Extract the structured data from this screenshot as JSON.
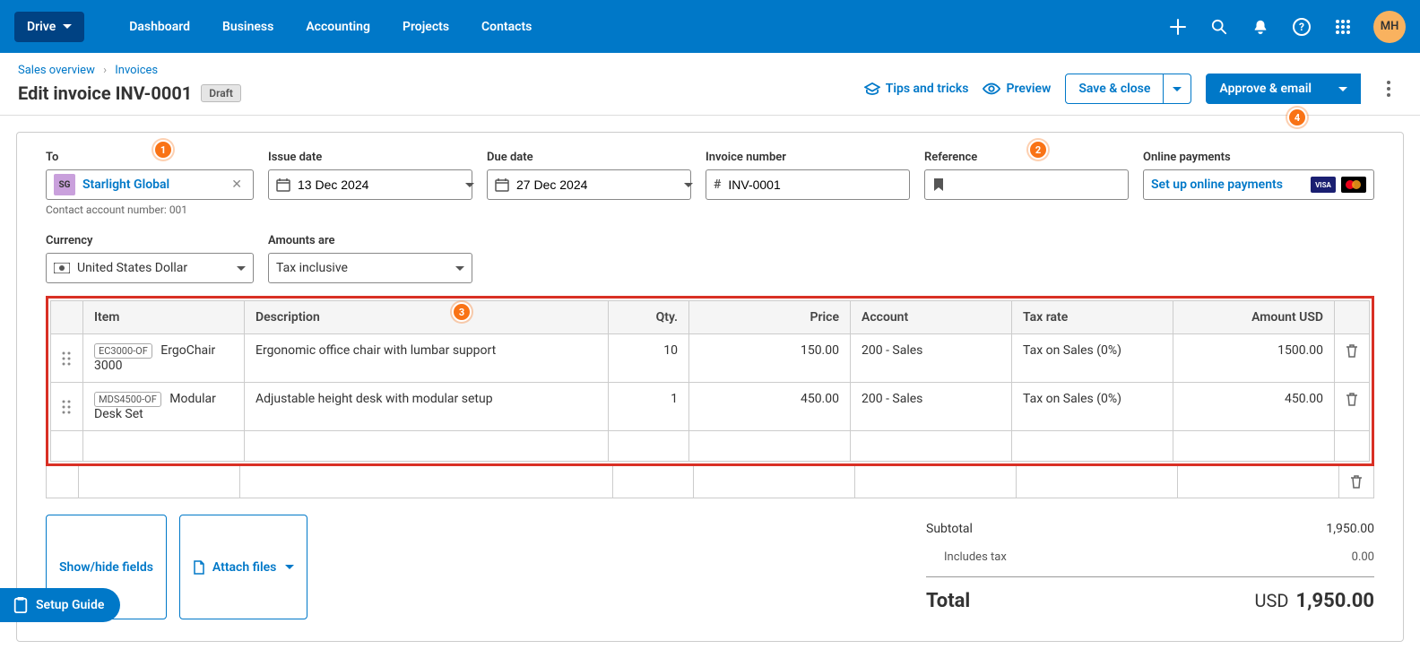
{
  "nav": {
    "org": "Drive",
    "links": [
      "Dashboard",
      "Business",
      "Accounting",
      "Projects",
      "Contacts"
    ],
    "avatar": "MH"
  },
  "breadcrumb": {
    "a": "Sales overview",
    "b": "Invoices"
  },
  "title": "Edit invoice INV-0001",
  "status": "Draft",
  "header_actions": {
    "tips": "Tips and tricks",
    "preview": "Preview",
    "save": "Save & close",
    "approve": "Approve & email"
  },
  "form": {
    "to_label": "To",
    "to_chip": "SG",
    "to_name": "Starlight Global",
    "to_help": "Contact account number: 001",
    "issue_label": "Issue date",
    "issue_value": "13 Dec 2024",
    "due_label": "Due date",
    "due_value": "27 Dec 2024",
    "invnum_label": "Invoice number",
    "invnum_value": "INV-0001",
    "ref_label": "Reference",
    "ref_value": "",
    "online_label": "Online payments",
    "online_btn": "Set up online payments",
    "currency_label": "Currency",
    "currency_value": "United States Dollar",
    "amounts_label": "Amounts are",
    "amounts_value": "Tax inclusive"
  },
  "columns": {
    "item": "Item",
    "desc": "Description",
    "qty": "Qty.",
    "price": "Price",
    "account": "Account",
    "tax": "Tax rate",
    "amount": "Amount USD"
  },
  "lines": [
    {
      "code": "EC3000-OF",
      "name": "ErgoChair 3000",
      "desc": "Ergonomic office chair with lumbar support",
      "qty": "10",
      "price": "150.00",
      "account": "200 - Sales",
      "tax": "Tax on Sales (0%)",
      "amount": "1500.00"
    },
    {
      "code": "MDS4500-OF",
      "name": "Modular Desk Set",
      "desc": "Adjustable height desk with modular setup",
      "qty": "1",
      "price": "450.00",
      "account": "200 - Sales",
      "tax": "Tax on Sales (0%)",
      "amount": "450.00"
    }
  ],
  "footer_buttons": {
    "showhide": "Show/hide fields",
    "attach": "Attach files"
  },
  "totals": {
    "subtotal_label": "Subtotal",
    "subtotal": "1,950.00",
    "tax_label": "Includes tax",
    "tax": "0.00",
    "total_label": "Total",
    "total_currency": "USD",
    "total": "1,950.00"
  },
  "setup_guide": "Setup Guide",
  "coach": {
    "c1": "1",
    "c2": "2",
    "c3": "3",
    "c4": "4"
  }
}
